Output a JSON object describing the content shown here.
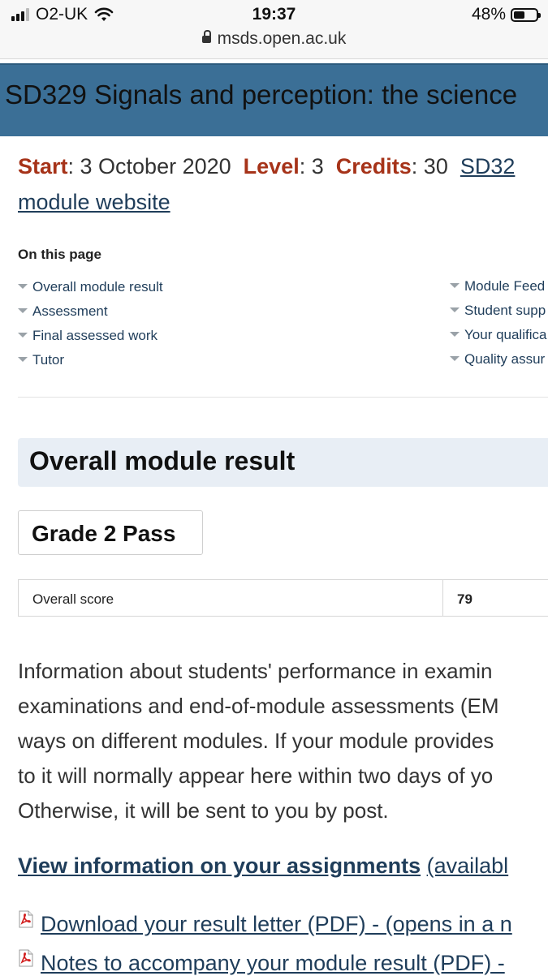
{
  "status_bar": {
    "carrier": "O2-UK",
    "time": "19:37",
    "battery": "48%",
    "url": "msds.open.ac.uk"
  },
  "header": {
    "title": "SD329 Signals and perception: the science"
  },
  "meta": {
    "start_label": "Start",
    "start_value": ": 3 October 2020",
    "level_label": "Level",
    "level_value": ": 3",
    "credits_label": "Credits",
    "credits_value": ": 30",
    "module_code_link": "SD32",
    "module_website_link": "module website"
  },
  "on_this_page": {
    "heading": "On this page",
    "left_items": [
      "Overall module result",
      "Assessment",
      "Final assessed work",
      "Tutor"
    ],
    "right_items": [
      "Module Feed",
      "Student supp",
      "Your qualifica",
      "Quality assur"
    ]
  },
  "overall": {
    "heading": "Overall module result",
    "grade": "Grade 2 Pass",
    "score_label": "Overall score",
    "score_value": "79"
  },
  "info_paragraph": [
    "Information about students' performance in examin",
    "examinations and end-of-module assessments (EM",
    "ways on different modules. If your module provides",
    "to it will normally appear here within two days of yo",
    "Otherwise, it will be sent to you by post."
  ],
  "assignments": {
    "link": "View information on your assignments",
    "suffix": "(availabl"
  },
  "downloads": [
    "Download your result letter (PDF) - (opens in a n",
    "Notes to accompany your module result (PDF) -"
  ],
  "colors": {
    "header_band": "#3b6f96",
    "label_red": "#a63319",
    "link_blue": "#1f3d5a",
    "section_bg": "#e8eef5"
  }
}
